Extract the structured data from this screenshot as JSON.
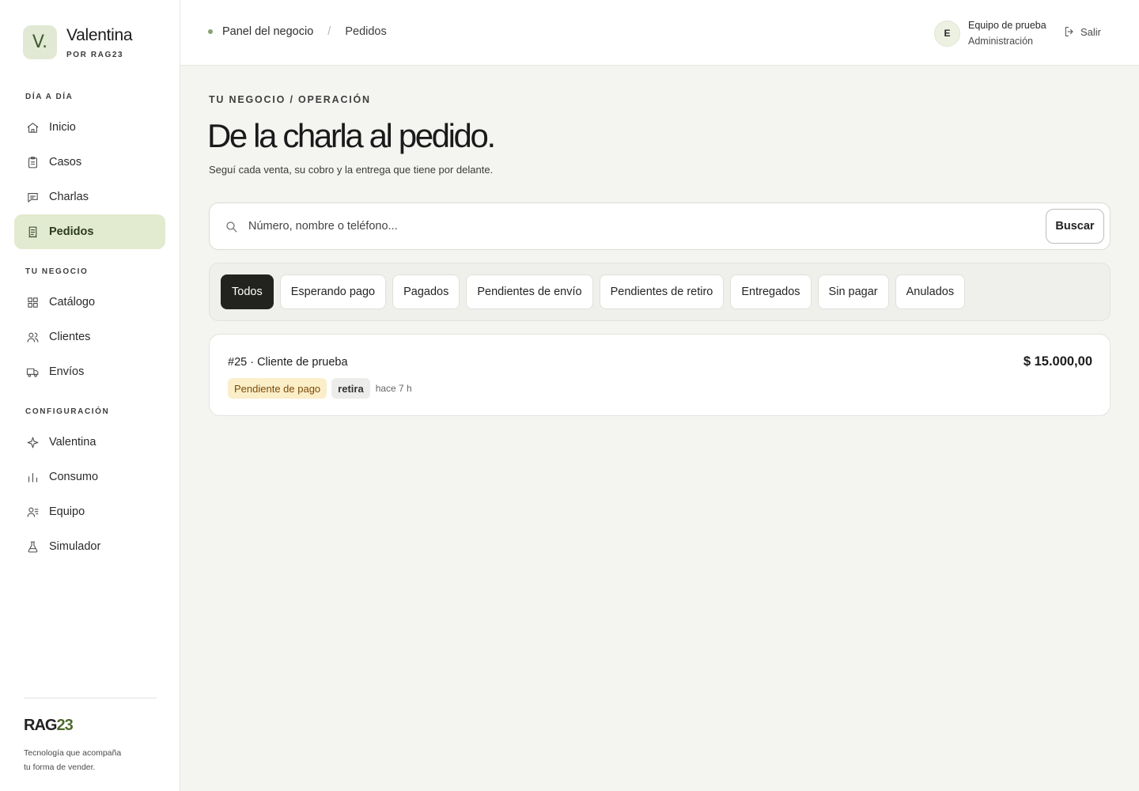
{
  "brand": {
    "initial": "V.",
    "name": "Valentina",
    "byline": "POR RAG23"
  },
  "sidebar": {
    "sections": [
      {
        "title": "DÍA A DÍA",
        "items": [
          {
            "label": "Inicio",
            "icon": "home-icon"
          },
          {
            "label": "Casos",
            "icon": "clipboard-icon"
          },
          {
            "label": "Charlas",
            "icon": "chat-icon"
          },
          {
            "label": "Pedidos",
            "icon": "receipt-icon",
            "active": true
          }
        ]
      },
      {
        "title": "TU NEGOCIO",
        "items": [
          {
            "label": "Catálogo",
            "icon": "grid-icon"
          },
          {
            "label": "Clientes",
            "icon": "users-icon"
          },
          {
            "label": "Envíos",
            "icon": "truck-icon"
          }
        ]
      },
      {
        "title": "CONFIGURACIÓN",
        "items": [
          {
            "label": "Valentina",
            "icon": "sparkle-icon"
          },
          {
            "label": "Consumo",
            "icon": "bar-chart-icon"
          },
          {
            "label": "Equipo",
            "icon": "team-icon"
          },
          {
            "label": "Simulador",
            "icon": "flask-icon"
          }
        ]
      }
    ],
    "footer": {
      "logo_main": "RAG",
      "logo_accent": "23",
      "tagline_1": "Tecnología que acompaña",
      "tagline_2": "tu forma de vender."
    }
  },
  "topbar": {
    "breadcrumb_root": "Panel del negocio",
    "breadcrumb_sep": "/",
    "breadcrumb_current": "Pedidos",
    "user_initial": "E",
    "user_name": "Equipo de prueba",
    "user_role": "Administración",
    "logout_label": "Salir"
  },
  "main": {
    "eyebrow": "TU NEGOCIO / OPERACIÓN",
    "title": "De la charla al pedido.",
    "subtitle": "Seguí cada venta, su cobro y la entrega que tiene por delante.",
    "search": {
      "placeholder": "Número, nombre o teléfono...",
      "value": "",
      "button": "Buscar"
    },
    "filters": [
      "Todos",
      "Esperando pago",
      "Pagados",
      "Pendientes de envío",
      "Pendientes de retiro",
      "Entregados",
      "Sin pagar",
      "Anulados"
    ],
    "active_filter": "Todos",
    "orders": [
      {
        "title": "#25 · Cliente de prueba",
        "amount": "$ 15.000,00",
        "status": "Pendiente de pago",
        "delivery": "retira",
        "time": "hace 7 h"
      }
    ]
  },
  "colors": {
    "accent": "#4d6b2e",
    "active_nav": "#e2eacf",
    "active_chip": "#22231f",
    "pending_badge": "#fbefc9"
  }
}
